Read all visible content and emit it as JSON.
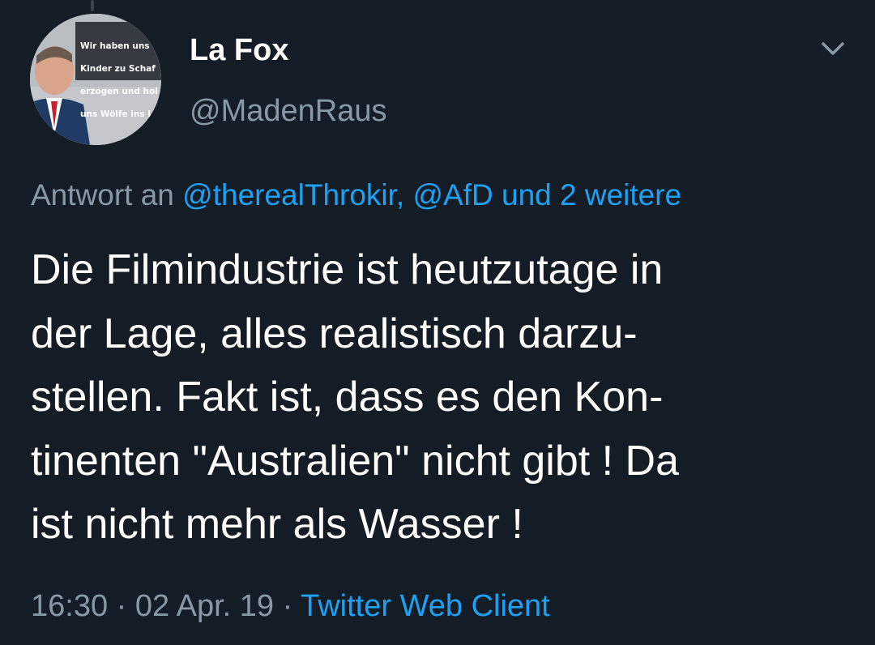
{
  "avatar": {
    "caption_lines": [
      "Wir haben uns",
      "Kinder zu Schaf",
      "erzogen und hol",
      "uns Wölfe ins Lan"
    ]
  },
  "user": {
    "display_name": "La Fox",
    "handle": "@MadenRaus"
  },
  "menu": {
    "icon": "chevron-down-icon"
  },
  "reply": {
    "prefix": "Antwort an ",
    "mentions": "@therealThrokir, @AfD und 2 weitere"
  },
  "tweet": {
    "lines": [
      "Die Filmindustrie ist heutzutage in",
      "der Lage, alles realistisch darzu-",
      "stellen. Fakt ist, dass es den Kon-",
      "tinenten \"Australien\" nicht gibt ! Da",
      "ist nicht mehr als Wasser !"
    ]
  },
  "meta": {
    "time": "16:30",
    "separator": " · ",
    "date": "02 Apr. 19",
    "client": "Twitter Web Client"
  },
  "colors": {
    "background": "#141d26",
    "secondary_text": "#8899a6",
    "link": "#1da1f2"
  }
}
